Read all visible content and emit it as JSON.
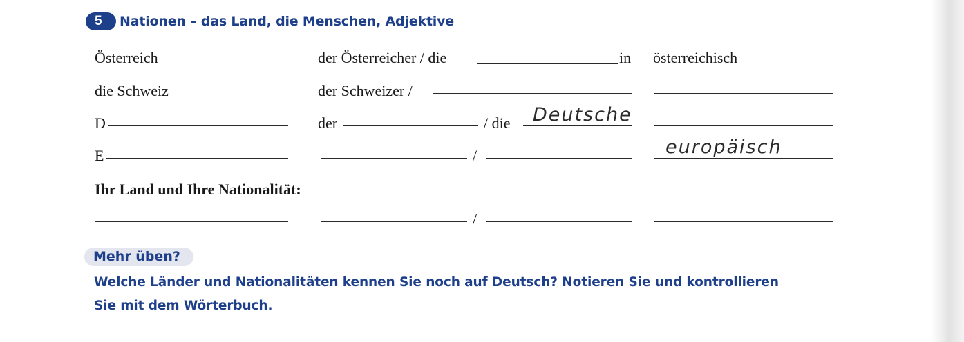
{
  "exercise": {
    "number": "5",
    "title": "Nationen – das Land, die Menschen, Adjektive"
  },
  "rows": {
    "r1": {
      "country": "Österreich",
      "person_prefix": "der Österreicher / die",
      "person_suffix": "in",
      "adjective": "österreichisch"
    },
    "r2": {
      "country": "die Schweiz",
      "person_prefix": "der Schweizer /"
    },
    "r3": {
      "country": "D",
      "male_prefix": "der",
      "female_prefix": "/ die",
      "female_handwritten": "Deutsche"
    },
    "r4": {
      "country": "E",
      "slash": "/",
      "adjective_handwritten": "europäisch"
    },
    "r5": {
      "slash": "/"
    }
  },
  "own_country_label": "Ihr Land und Ihre Nationalität:",
  "more_practice": {
    "label": "Mehr üben?",
    "line1": "Welche Länder und Nationalitäten kennen Sie noch auf Deutsch? Notieren Sie und kontrollieren",
    "line2": "Sie mit dem Wörterbuch."
  }
}
